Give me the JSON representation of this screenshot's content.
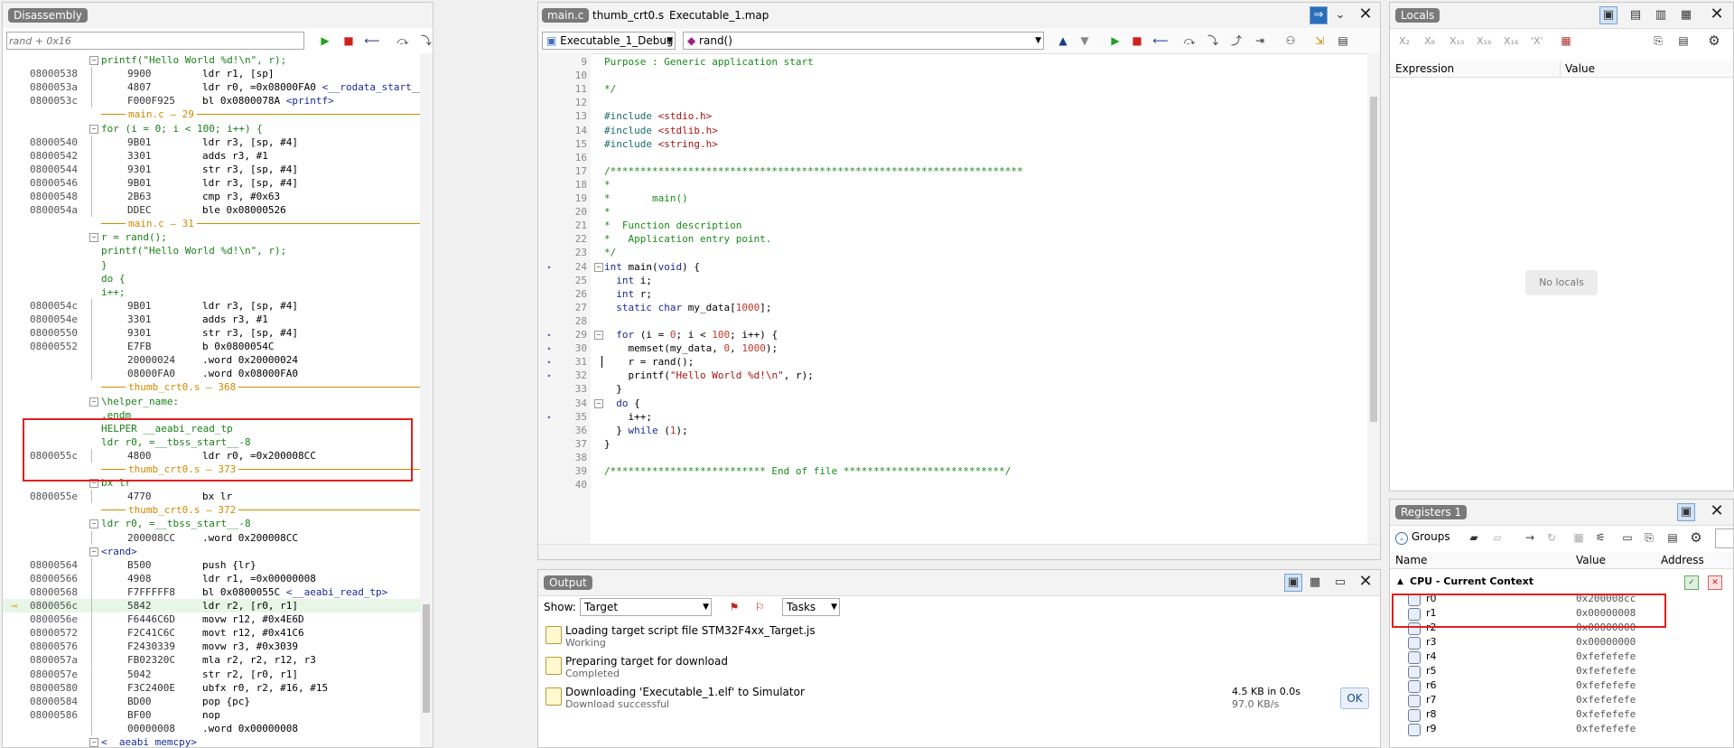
{
  "disassembly": {
    "title": "Disassembly",
    "address_placeholder": "rand + 0x16",
    "lines": [
      {
        "t": "src",
        "text": "printf(\"Hello World %d!\\n\", r);"
      },
      {
        "t": "ins",
        "addr": "08000538",
        "hex": "9900",
        "asm": "ldr r1, [sp]"
      },
      {
        "t": "ins",
        "addr": "0800053a",
        "hex": "4807",
        "asm": "ldr r0, =0x08000FA0 ",
        "link": "<__rodata_start__>"
      },
      {
        "t": "ins",
        "addr": "0800053c",
        "hex": "F000F925",
        "asm": "bl 0x0800078A ",
        "link": "<printf>"
      },
      {
        "t": "sep",
        "text": "main.c — 29"
      },
      {
        "t": "src",
        "text": "for (i = 0; i < 100; i++) {"
      },
      {
        "t": "ins",
        "addr": "08000540",
        "hex": "9B01",
        "asm": "ldr r3, [sp, #4]"
      },
      {
        "t": "ins",
        "addr": "08000542",
        "hex": "3301",
        "asm": "adds r3, #1"
      },
      {
        "t": "ins",
        "addr": "08000544",
        "hex": "9301",
        "asm": "str r3, [sp, #4]"
      },
      {
        "t": "ins",
        "addr": "08000546",
        "hex": "9B01",
        "asm": "ldr r3, [sp, #4]"
      },
      {
        "t": "ins",
        "addr": "08000548",
        "hex": "2B63",
        "asm": "cmp r3, #0x63"
      },
      {
        "t": "ins",
        "addr": "0800054a",
        "hex": "DDEC",
        "asm": "ble 0x08000526"
      },
      {
        "t": "sep",
        "text": "main.c — 31"
      },
      {
        "t": "src",
        "text": "r = rand();"
      },
      {
        "t": "src",
        "text": "printf(\"Hello World %d!\\n\", r);"
      },
      {
        "t": "src",
        "text": "}"
      },
      {
        "t": "src",
        "text": "do {"
      },
      {
        "t": "src",
        "text": "i++;"
      },
      {
        "t": "ins",
        "addr": "0800054c",
        "hex": "9B01",
        "asm": "ldr r3, [sp, #4]"
      },
      {
        "t": "ins",
        "addr": "0800054e",
        "hex": "3301",
        "asm": "adds r3, #1"
      },
      {
        "t": "ins",
        "addr": "08000550",
        "hex": "9301",
        "asm": "str r3, [sp, #4]"
      },
      {
        "t": "ins",
        "addr": "08000552",
        "hex": "E7FB",
        "asm": "b 0x0800054C"
      },
      {
        "t": "ins",
        "addr": "",
        "hex": "20000024",
        "asm": ".word 0x20000024"
      },
      {
        "t": "ins",
        "addr": "",
        "hex": "08000FA0",
        "asm": ".word 0x08000FA0"
      },
      {
        "t": "sep",
        "text": "thumb_crt0.s — 368"
      },
      {
        "t": "src",
        "text": "\\helper_name:"
      },
      {
        "t": "src",
        "text": ".endm"
      },
      {
        "t": "src",
        "text": "HELPER __aeabi_read_tp"
      },
      {
        "t": "src",
        "text": "ldr r0, =__tbss_start__-8"
      },
      {
        "t": "ins",
        "addr": "0800055c",
        "hex": "4800",
        "asm": "ldr r0, =0x200008CC"
      },
      {
        "t": "sep",
        "text": "thumb_crt0.s — 373"
      },
      {
        "t": "src",
        "text": "bx lr"
      },
      {
        "t": "ins",
        "addr": "0800055e",
        "hex": "4770",
        "asm": "bx lr"
      },
      {
        "t": "sep",
        "text": "thumb_crt0.s — 372"
      },
      {
        "t": "src",
        "text": "ldr r0, =__tbss_start__-8"
      },
      {
        "t": "ins",
        "addr": "",
        "hex": "200008CC",
        "asm": ".word 0x200008CC"
      },
      {
        "t": "blk",
        "text": "<rand>"
      },
      {
        "t": "ins",
        "addr": "08000564",
        "hex": "B500",
        "asm": "push {lr}"
      },
      {
        "t": "ins",
        "addr": "08000566",
        "hex": "4908",
        "asm": "ldr r1, =0x00000008"
      },
      {
        "t": "ins",
        "addr": "08000568",
        "hex": "F7FFFFF8",
        "asm": "bl 0x0800055C ",
        "link": "<__aeabi_read_tp>"
      },
      {
        "t": "cur",
        "addr": "0800056c",
        "hex": "5842",
        "asm": "ldr r2, [r0, r1]"
      },
      {
        "t": "ins",
        "addr": "0800056e",
        "hex": "F6446C6D",
        "asm": "movw r12, #0x4E6D"
      },
      {
        "t": "ins",
        "addr": "08000572",
        "hex": "F2C41C6C",
        "asm": "movt r12, #0x41C6"
      },
      {
        "t": "ins",
        "addr": "08000576",
        "hex": "F2430339",
        "asm": "movw r3, #0x3039"
      },
      {
        "t": "ins",
        "addr": "0800057a",
        "hex": "FB02320C",
        "asm": "mla r2, r2, r12, r3"
      },
      {
        "t": "ins",
        "addr": "0800057e",
        "hex": "5042",
        "asm": "str r2, [r0, r1]"
      },
      {
        "t": "ins",
        "addr": "08000580",
        "hex": "F3C2400E",
        "asm": "ubfx r0, r2, #16, #15"
      },
      {
        "t": "ins",
        "addr": "08000584",
        "hex": "BD00",
        "asm": "pop {pc}"
      },
      {
        "t": "ins",
        "addr": "08000586",
        "hex": "BF00",
        "asm": "nop"
      },
      {
        "t": "ins",
        "addr": "",
        "hex": "00000008",
        "asm": ".word 0x00000008"
      },
      {
        "t": "blk",
        "text": "<__aeabi_memcpy>"
      }
    ]
  },
  "editor": {
    "tabs": [
      "main.c",
      "thumb_crt0.s",
      "Executable_1.map"
    ],
    "config": "Executable_1_Debug",
    "function": "rand()",
    "lines": [
      {
        "n": "9",
        "h": [
          [
            "cm",
            "Purpose : Generic application start"
          ]
        ]
      },
      {
        "n": "10",
        "h": []
      },
      {
        "n": "11",
        "h": [
          [
            "cm",
            "*/"
          ]
        ]
      },
      {
        "n": "12",
        "h": []
      },
      {
        "n": "13",
        "h": [
          [
            "pp",
            "#include "
          ],
          [
            "str",
            "<stdio.h>"
          ]
        ]
      },
      {
        "n": "14",
        "h": [
          [
            "pp",
            "#include "
          ],
          [
            "str",
            "<stdlib.h>"
          ]
        ]
      },
      {
        "n": "15",
        "h": [
          [
            "pp",
            "#include "
          ],
          [
            "str",
            "<string.h>"
          ]
        ]
      },
      {
        "n": "16",
        "h": []
      },
      {
        "n": "17",
        "h": [
          [
            "cm",
            "/*********************************************************************"
          ]
        ]
      },
      {
        "n": "18",
        "h": [
          [
            "cm",
            "*"
          ]
        ]
      },
      {
        "n": "19",
        "h": [
          [
            "cm",
            "*       main()"
          ]
        ]
      },
      {
        "n": "20",
        "h": [
          [
            "cm",
            "*"
          ]
        ]
      },
      {
        "n": "21",
        "h": [
          [
            "cm",
            "*  Function description"
          ]
        ]
      },
      {
        "n": "22",
        "h": [
          [
            "cm",
            "*   Application entry point."
          ]
        ]
      },
      {
        "n": "23",
        "h": [
          [
            "cm",
            "*/"
          ]
        ]
      },
      {
        "n": "24",
        "h": [
          [
            "kw",
            "int "
          ],
          [
            "",
            "main("
          ],
          [
            "kw",
            "void"
          ],
          [
            "",
            ") {"
          ]
        ],
        "m": true
      },
      {
        "n": "25",
        "h": [
          [
            "",
            "  "
          ],
          [
            "kw",
            "int "
          ],
          [
            "",
            "i;"
          ]
        ]
      },
      {
        "n": "26",
        "h": [
          [
            "",
            "  "
          ],
          [
            "kw",
            "int "
          ],
          [
            "",
            "r;"
          ]
        ]
      },
      {
        "n": "27",
        "h": [
          [
            "",
            "  "
          ],
          [
            "kw",
            "static char "
          ],
          [
            "",
            "my_data["
          ],
          [
            "num",
            "1000"
          ],
          [
            "",
            "];"
          ]
        ]
      },
      {
        "n": "28",
        "h": []
      },
      {
        "n": "29",
        "h": [
          [
            "",
            "  "
          ],
          [
            "kw",
            "for "
          ],
          [
            "",
            "(i = "
          ],
          [
            "num",
            "0"
          ],
          [
            "",
            "; i < "
          ],
          [
            "num",
            "100"
          ],
          [
            "",
            "; i++) {"
          ]
        ],
        "m": true
      },
      {
        "n": "30",
        "h": [
          [
            "",
            "    memset(my_data, "
          ],
          [
            "num",
            "0"
          ],
          [
            "",
            ", "
          ],
          [
            "num",
            "1000"
          ],
          [
            "",
            ");"
          ]
        ],
        "m": true
      },
      {
        "n": "31",
        "h": [
          [
            "",
            "    r = rand();"
          ]
        ],
        "m": true,
        "cur": true
      },
      {
        "n": "32",
        "h": [
          [
            "",
            "    printf("
          ],
          [
            "str",
            "\"Hello World %d!\\n\""
          ],
          [
            "",
            ", r);"
          ]
        ],
        "m": true
      },
      {
        "n": "33",
        "h": [
          [
            "",
            "  }"
          ]
        ]
      },
      {
        "n": "34",
        "h": [
          [
            "",
            "  "
          ],
          [
            "kw",
            "do "
          ],
          [
            "",
            "{"
          ]
        ]
      },
      {
        "n": "35",
        "h": [
          [
            "",
            "    i++;"
          ]
        ],
        "m": true
      },
      {
        "n": "36",
        "h": [
          [
            "",
            "  } "
          ],
          [
            "kw",
            "while "
          ],
          [
            "",
            "("
          ],
          [
            "num",
            "1"
          ],
          [
            "",
            ");"
          ]
        ]
      },
      {
        "n": "37",
        "h": [
          [
            "",
            "}"
          ]
        ]
      },
      {
        "n": "38",
        "h": []
      },
      {
        "n": "39",
        "h": [
          [
            "cm",
            "/************************** End of file ***************************/"
          ]
        ]
      },
      {
        "n": "40",
        "h": []
      }
    ]
  },
  "output": {
    "title": "Output",
    "show_label": "Show:",
    "show_value": "Target",
    "tasks_value": "Tasks",
    "items": [
      {
        "title": "Loading target script file STM32F4xx_Target.js",
        "status": "Working"
      },
      {
        "title": "Preparing target for download",
        "status": "Completed"
      },
      {
        "title": "Downloading 'Executable_1.elf' to Simulator",
        "status": "Download successful",
        "size": "4.5 KB in 0.0s",
        "rate": "97.0 KB/s",
        "ok": "OK"
      }
    ]
  },
  "locals": {
    "title": "Locals",
    "col_expression": "Expression",
    "col_value": "Value",
    "empty": "No locals",
    "toolbar": [
      "X₂",
      "X₈",
      "X₁₀",
      "X₁₆",
      "X₁₆",
      "'X'"
    ]
  },
  "registers": {
    "title": "Registers 1",
    "groups": "Groups",
    "col_name": "Name",
    "col_value": "Value",
    "col_address": "Address",
    "group_title": "CPU - Current Context",
    "rows": [
      {
        "name": "r0",
        "value": "0x200008cc"
      },
      {
        "name": "r1",
        "value": "0x00000008"
      },
      {
        "name": "r2",
        "value": "0x00000000"
      },
      {
        "name": "r3",
        "value": "0x00000000"
      },
      {
        "name": "r4",
        "value": "0xfefefefe"
      },
      {
        "name": "r5",
        "value": "0xfefefefe"
      },
      {
        "name": "r6",
        "value": "0xfefefefe"
      },
      {
        "name": "r7",
        "value": "0xfefefefe"
      },
      {
        "name": "r8",
        "value": "0xfefefefe"
      },
      {
        "name": "r9",
        "value": "0xfefefefe"
      }
    ]
  },
  "colors": {
    "highlight_box": "#e02020",
    "accent": "#3b6fb6",
    "current_line": "#e8f6e8"
  }
}
